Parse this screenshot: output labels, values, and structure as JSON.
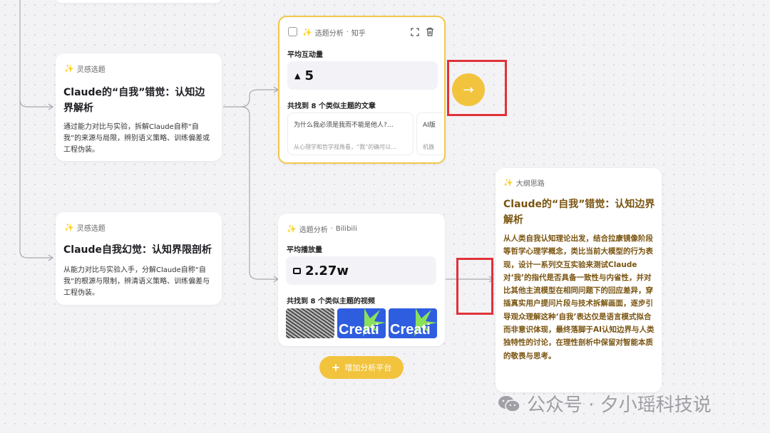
{
  "topic_cards": [
    {
      "tag": "灵感选题",
      "title": "Claude的“自我”错觉：认知边界解析",
      "desc": "通过能力对比与实验，拆解Claude自称“自我”的来源与局限，辨别语义策略、训练偏差或工程伪装。"
    },
    {
      "tag": "灵感选题",
      "title": "Claude自我幻觉：认知界限剖析",
      "desc": "从能力对比与实验入手，分解Claude自称“自我”的根源与限制，辨清语义策略、训练偏差与工程伪装。"
    }
  ],
  "zhihu_card": {
    "tag": "选题分析",
    "platform": "知乎",
    "metric_label": "平均互动量",
    "metric_value": "5",
    "found_label": "共找到 8 个类似主题的文章",
    "articles": [
      {
        "title": "为什么我必须是我而不能是他人?…",
        "snippet": "从心理学和哲学视角看，“我”的确可以…"
      },
      {
        "title": "AI版",
        "snippet": "机器"
      }
    ],
    "icons": [
      "checkbox-icon",
      "expand-icon",
      "trash-icon"
    ]
  },
  "bilibili_card": {
    "tag": "选题分析",
    "platform": "Bilibili",
    "metric_label": "平均播放量",
    "metric_value": "2.27w",
    "found_label": "共找到 8 个类似主题的视频",
    "thumb_text": "Creati"
  },
  "add_platform": {
    "label": "增加分析平台"
  },
  "outline_card": {
    "tag": "大纲思路",
    "title": "Claude的“自我”错觉：认知边界解析",
    "body": "从人类自我认知理论出发，结合拉康镜像阶段等哲学心理学概念，类比当前大模型的行为表现，设计一系列交互实验来测试Claude对‘我’的指代是否具备一致性与内省性，并对比其他主流模型在相同问题下的回应差异，穿插真实用户提问片段与技术拆解画面，逐步引导观众理解这种‘自我’表达仅是语言模式拟合而非意识体现，最终落脚于AI认知边界与人类独特性的讨论，在理性剖析中保留对智能本质的敬畏与思考。"
  },
  "watermark": {
    "text": "公众号 · 夕小瑶科技说"
  },
  "colors": {
    "accent": "#f2c33d",
    "highlight_red": "#e0323a",
    "outline_text": "#7a5410"
  }
}
